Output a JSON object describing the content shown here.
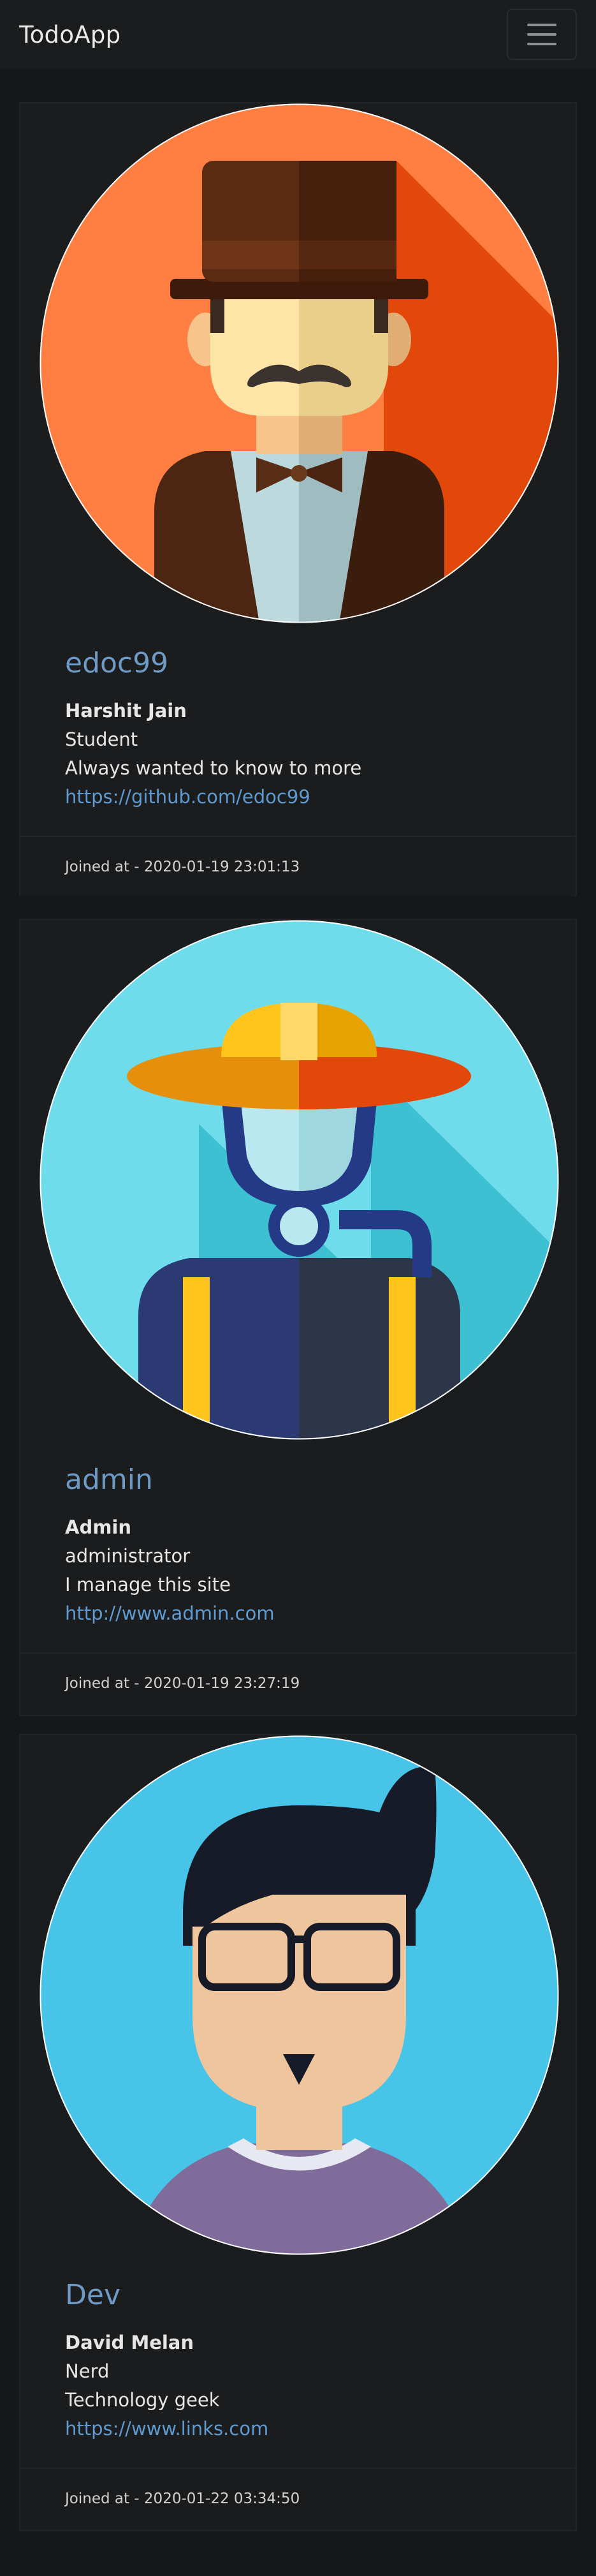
{
  "app": {
    "brand": "TodoApp",
    "menu_icon": "hamburger-menu-icon"
  },
  "users": [
    {
      "username": "edoc99",
      "name": "Harshit Jain",
      "occupation": "Student",
      "bio": "Always wanted to know to more",
      "website": "https://github.com/edoc99",
      "joined_label": "Joined at - ",
      "joined": "2020-01-19 23:01:13",
      "avatar": "gentleman-avatar-icon"
    },
    {
      "username": "admin",
      "name": "Admin",
      "occupation": "administrator",
      "bio": "I manage this site",
      "website": "http://www.admin.com",
      "joined_label": "Joined at - ",
      "joined": "2020-01-19 23:27:19",
      "avatar": "diver-avatar-icon"
    },
    {
      "username": "Dev",
      "name": "David Melan",
      "occupation": "Nerd",
      "bio": "Technology geek",
      "website": "https://www.links.com",
      "joined_label": "Joined at - ",
      "joined": "2020-01-22 03:34:50",
      "avatar": "nerd-avatar-icon"
    }
  ],
  "colors": {
    "link": "#5f9bd0",
    "username": "#6f9ac6",
    "background": "#161718"
  }
}
